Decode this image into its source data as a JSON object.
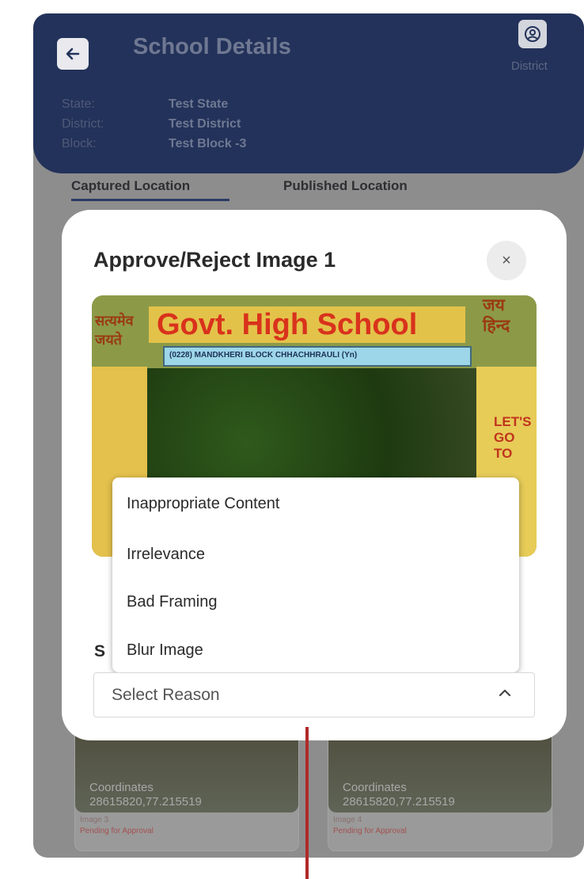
{
  "header": {
    "title": "School Details",
    "district_label": "District",
    "info": [
      {
        "key": "State:",
        "value": "Test State"
      },
      {
        "key": "District:",
        "value": "Test District"
      },
      {
        "key": "Block:",
        "value": "Test Block -3"
      }
    ]
  },
  "tabs": [
    {
      "label": "Captured Location"
    },
    {
      "label": "Published Location"
    }
  ],
  "cards": [
    {
      "coord_label": "Coordinates",
      "coord_value": "28615820,77.215519",
      "image": "Image 3",
      "status": "Pending for Approval"
    },
    {
      "coord_label": "Coordinates",
      "coord_value": "28615820,77.215519",
      "image": "Image 4",
      "status": "Pending for Approval"
    }
  ],
  "modal": {
    "title": "Approve/Reject Image 1",
    "close_glyph": "×",
    "photo": {
      "sign": "Govt. High School",
      "strip": "(0228) MANDKHERI BLOCK CHHACHHRAULI (Yn)",
      "hindi_left": "सत्यमेव जयते",
      "hindi_right": "जय हिन्द",
      "lets_go": "LET'S GO TO"
    },
    "reason_label_partial": "S",
    "select_placeholder": "Select Reason",
    "options": [
      "Inappropriate Content",
      "Irrelevance",
      "Bad Framing",
      "Blur Image"
    ]
  },
  "colors": {
    "header_bg": "#23325a",
    "backdrop": "#8d8d8d",
    "annotation_line": "#b22929"
  }
}
